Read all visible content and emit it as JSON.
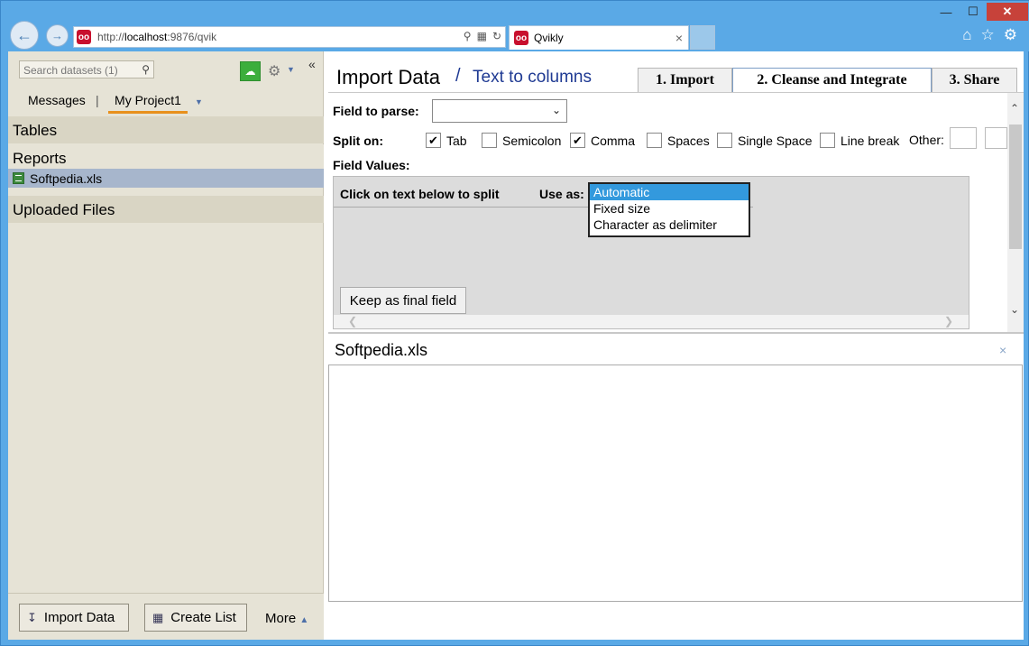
{
  "browser": {
    "url_prefix": "http://",
    "url_host": "localhost",
    "url_rest": ":9876/qvik",
    "tab_title": "Qvikly",
    "tab_close": "×",
    "icons": [
      "back-icon",
      "forward-icon",
      "search-icon",
      "refresh-icon",
      "home-icon",
      "star-icon",
      "gear-icon"
    ]
  },
  "window_controls": {
    "minimize": "—",
    "maximize": "☐",
    "close": "✕"
  },
  "sidebar": {
    "search_placeholder": "Search datasets (1)",
    "tabs": {
      "messages": "Messages",
      "separator": "|",
      "project": "My Project1"
    },
    "sections": {
      "tables": "Tables",
      "reports": "Reports",
      "uploaded": "Uploaded Files"
    },
    "file": "Softpedia.xls",
    "footer": {
      "import": "Import Data",
      "create_list": "Create List",
      "more": "More"
    }
  },
  "main": {
    "title": "Import Data",
    "title_sep": "/",
    "subtitle": "Text to columns",
    "steps": [
      "1. Import",
      "2. Cleanse and Integrate",
      "3. Share"
    ],
    "active_step": 2,
    "field_to_parse_label": "Field to parse:",
    "field_to_parse_value": "",
    "split_on_label": "Split on:",
    "split_options": [
      {
        "label": "Tab",
        "checked": true
      },
      {
        "label": "Semicolon",
        "checked": false
      },
      {
        "label": "Comma",
        "checked": true
      },
      {
        "label": "Spaces",
        "checked": false
      },
      {
        "label": "Single Space",
        "checked": false
      },
      {
        "label": "Line break",
        "checked": false
      }
    ],
    "other_label": "Other:",
    "field_values_label": "Field Values:",
    "click_text": "Click on text below to split",
    "use_as_label": "Use as:",
    "use_as_options": [
      "Automatic",
      "Fixed size",
      "Character as delimiter"
    ],
    "use_as_selected": "Automatic",
    "keep_button": "Keep as final field",
    "file_panel_title": "Softpedia.xls",
    "file_panel_close": "×"
  },
  "colors": {
    "accent": "#e8901c",
    "selection": "#3399dd",
    "link": "#1f3a93"
  }
}
